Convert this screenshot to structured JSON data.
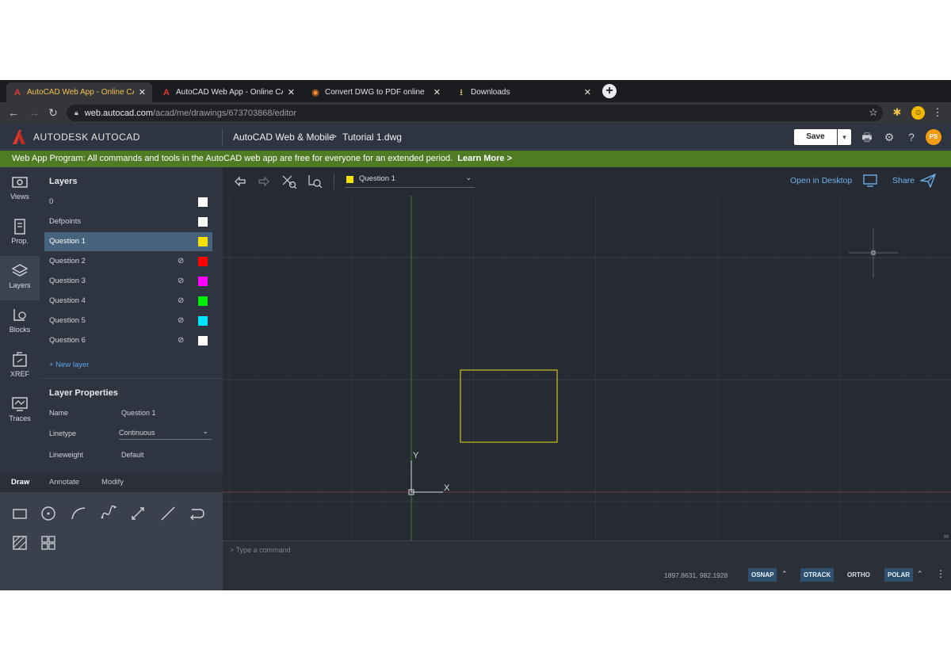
{
  "browser": {
    "tabs": [
      {
        "title": "AutoCAD Web App - Online CAD",
        "icon": "autocad-icon",
        "active": true
      },
      {
        "title": "AutoCAD Web App - Online CAD",
        "icon": "autocad-icon",
        "active": false
      },
      {
        "title": "Convert DWG to PDF online",
        "icon": "converter-icon",
        "active": false
      },
      {
        "title": "Downloads",
        "icon": "download-icon",
        "active": false
      }
    ],
    "url_host": "web.autocad.com",
    "url_path": "/acad/me/drawings/673703868/editor",
    "profile_initial": "☺"
  },
  "app": {
    "brand_prefix": "AUTODESK",
    "brand_name": "AUTOCAD",
    "breadcrumb_app": "AutoCAD Web & Mobile",
    "breadcrumb_sep": ">",
    "breadcrumb_file": "Tutorial 1.dwg",
    "save_label": "Save",
    "user_initials": "PS"
  },
  "banner": {
    "text": "Web App Program: All commands and tools in the AutoCAD web app are free for everyone for an extended period.",
    "link": "Learn More >"
  },
  "rail": {
    "items": [
      {
        "label": "Views",
        "icon": "views-icon"
      },
      {
        "label": "Prop.",
        "icon": "properties-icon"
      },
      {
        "label": "Layers",
        "icon": "layers-icon"
      },
      {
        "label": "Blocks",
        "icon": "blocks-icon"
      },
      {
        "label": "XREF",
        "icon": "xref-icon"
      },
      {
        "label": "Traces",
        "icon": "traces-icon"
      }
    ]
  },
  "layers_panel": {
    "title": "Layers",
    "layers": [
      {
        "name": "0",
        "color": "#ffffff",
        "bulb": false
      },
      {
        "name": "Defpoints",
        "color": "#ffffff",
        "bulb": false
      },
      {
        "name": "Question 1",
        "color": "#f5e100",
        "bulb": false,
        "selected": true
      },
      {
        "name": "Question 2",
        "color": "#ff0000",
        "bulb": true
      },
      {
        "name": "Question 3",
        "color": "#ff00ff",
        "bulb": true
      },
      {
        "name": "Question 4",
        "color": "#00ee00",
        "bulb": true
      },
      {
        "name": "Question 5",
        "color": "#00e5ff",
        "bulb": true
      },
      {
        "name": "Question 6",
        "color": "#ffffff",
        "bulb": true
      }
    ],
    "new_layer": "+ New layer",
    "properties_title": "Layer Properties",
    "props": {
      "name_label": "Name",
      "name_value": "Question 1",
      "linetype_label": "Linetype",
      "linetype_value": "Continuous",
      "lineweight_label": "Lineweight",
      "lineweight_value": "Default"
    }
  },
  "draw_panel": {
    "tabs": [
      "Draw",
      "Annotate",
      "Modify"
    ],
    "active_tab": "Draw"
  },
  "canvas": {
    "current_layer": "Question 1",
    "current_layer_color": "#f5e100",
    "open_in_desktop": "Open in Desktop",
    "share": "Share",
    "ucs_x": "X",
    "ucs_y": "Y",
    "rectangle_color": "#c9c21c"
  },
  "command_line": {
    "placeholder": "> Type a command"
  },
  "status_bar": {
    "coordinates": "1897.8631, 982.1928",
    "osnap": "OSNAP",
    "otrack": "OTRACK",
    "ortho": "ORTHO",
    "polar": "POLAR",
    "more": "⋮"
  }
}
